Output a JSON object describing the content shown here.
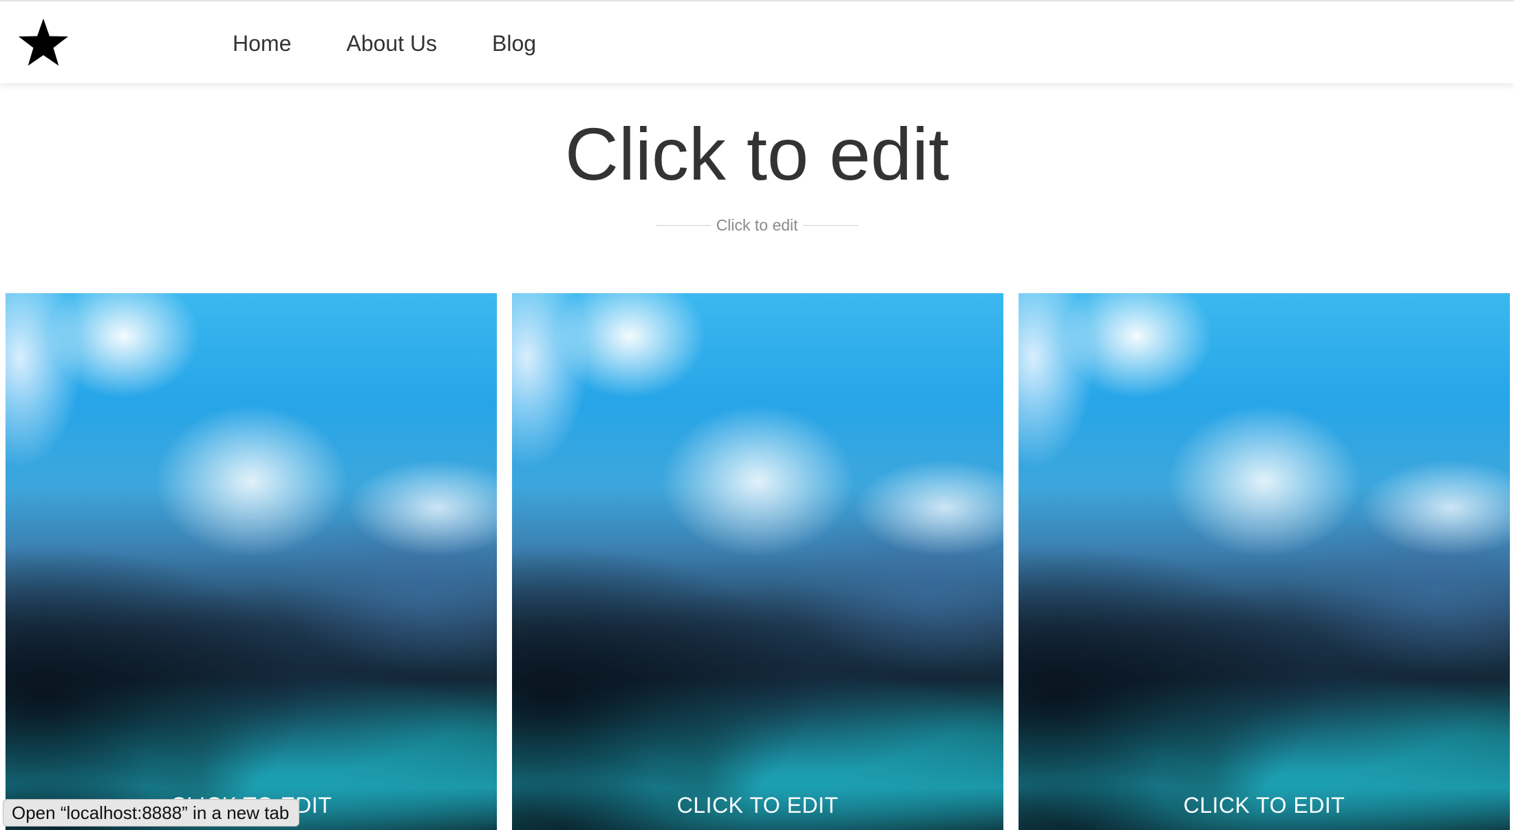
{
  "header": {
    "logo_icon": "star-icon",
    "nav": [
      {
        "label": "Home"
      },
      {
        "label": "About Us"
      },
      {
        "label": "Blog"
      }
    ]
  },
  "hero": {
    "title": "Click to edit",
    "subtitle": "Click to edit"
  },
  "cards": [
    {
      "label": "CLICK TO EDIT",
      "image": "blurred-mountain-lake-photo"
    },
    {
      "label": "CLICK TO EDIT",
      "image": "blurred-mountain-lake-photo"
    },
    {
      "label": "CLICK TO EDIT",
      "image": "blurred-mountain-lake-photo"
    }
  ],
  "status_bar": {
    "text": "Open “localhost:8888” in a new tab"
  },
  "colors": {
    "text_dark": "#333333",
    "text_muted": "#8a8a8a",
    "card_label": "#ffffff"
  }
}
